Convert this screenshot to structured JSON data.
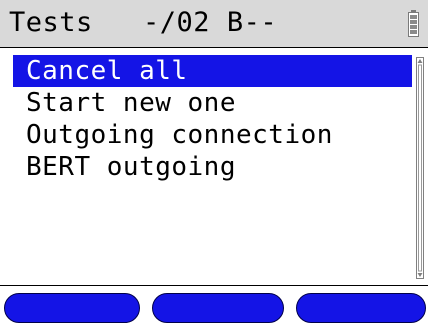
{
  "header": {
    "title": "Tests   -/02 B--",
    "battery_icon": "battery-icon"
  },
  "menu": {
    "items": [
      {
        "label": "Cancel all",
        "selected": true
      },
      {
        "label": "Start new one",
        "selected": false
      },
      {
        "label": "Outgoing connection",
        "selected": false
      },
      {
        "label": "BERT outgoing",
        "selected": false
      }
    ]
  },
  "softkeys": [
    {
      "label": ""
    },
    {
      "label": ""
    },
    {
      "label": ""
    }
  ],
  "colors": {
    "selection": "#1414e6",
    "titlebar": "#d9d9d9",
    "softkey": "#1414e6"
  }
}
